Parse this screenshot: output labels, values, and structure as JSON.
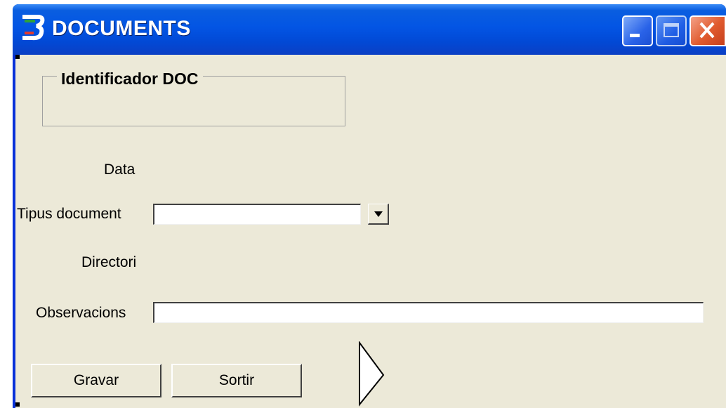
{
  "window": {
    "title": "DOCUMENTS",
    "app_icon": "brand-logo-icon",
    "controls": [
      "minimize-icon",
      "maximize-icon",
      "close-icon"
    ]
  },
  "form": {
    "group_title": "Identificador DOC",
    "data_label": "Data",
    "tipus_label": "Tipus document",
    "tipus_value": "",
    "directori_label": "Directori",
    "observacions_label": "Observacions",
    "observacions_value": ""
  },
  "buttons": {
    "save": "Gravar",
    "exit": "Sortir"
  },
  "colors": {
    "titlebar": "#0355e4",
    "client": "#ece9d8",
    "close": "#e05a2e"
  }
}
